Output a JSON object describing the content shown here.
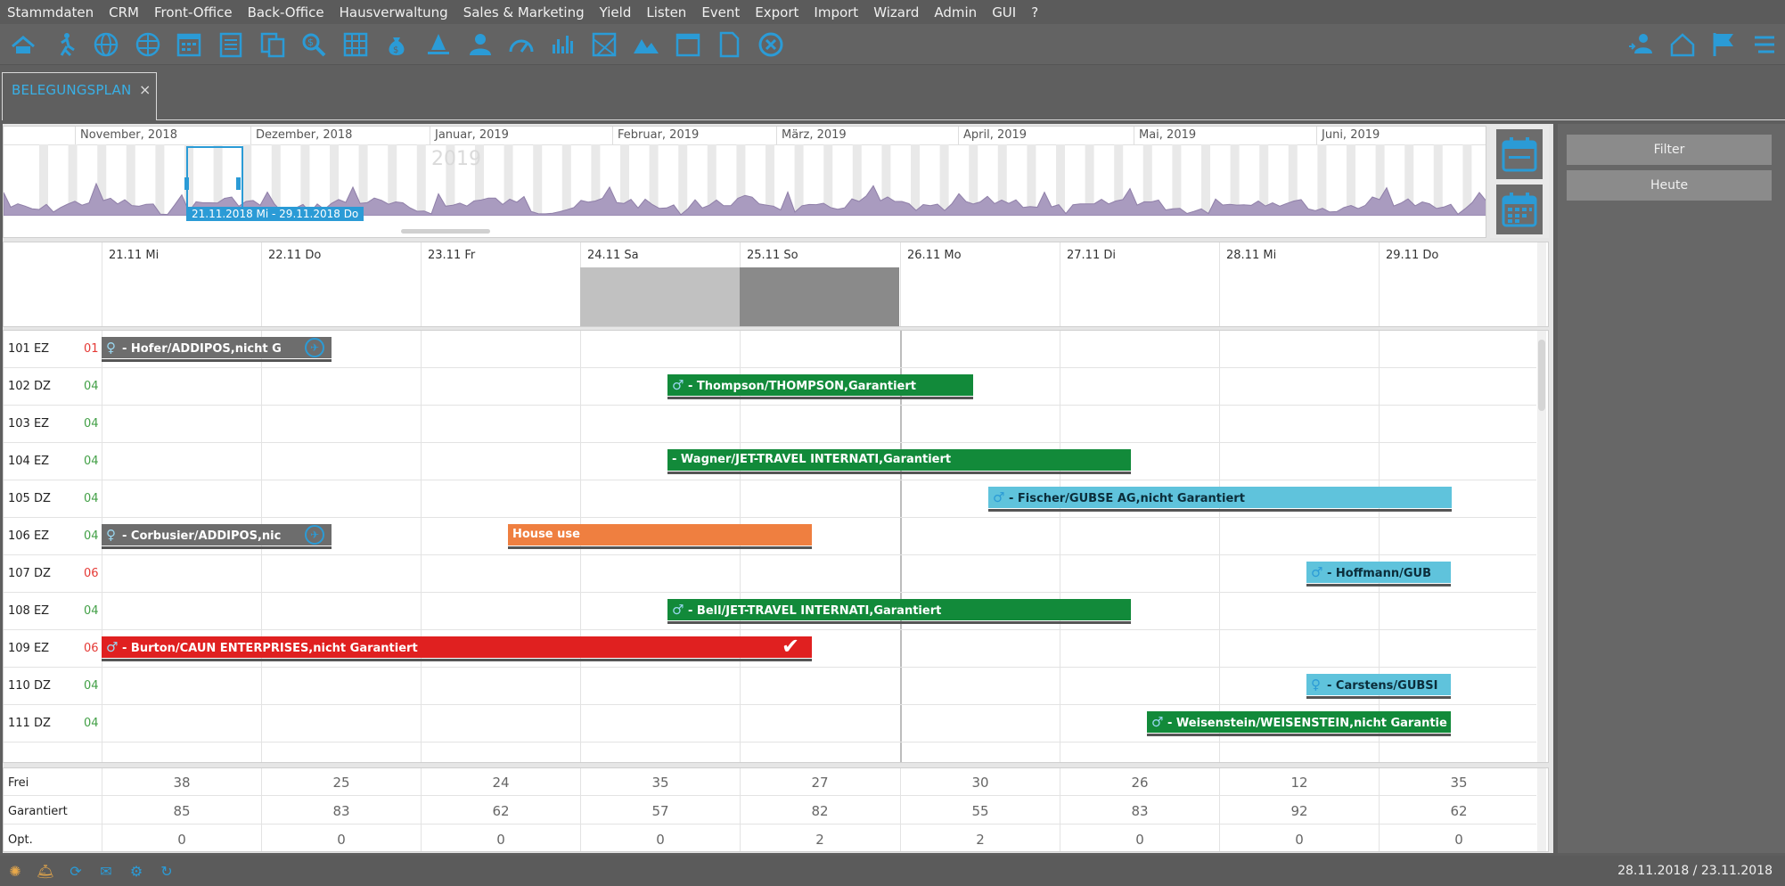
{
  "menu": [
    "Stammdaten",
    "CRM",
    "Front-Office",
    "Back-Office",
    "Hausverwaltung",
    "Sales & Marketing",
    "Yield",
    "Listen",
    "Event",
    "Export",
    "Import",
    "Wizard",
    "Admin",
    "GUI",
    "?"
  ],
  "toolbar_icons": [
    "hotel-icon",
    "walk-in-icon",
    "globe-icon",
    "globe-grid-icon",
    "calendar-grid-icon",
    "list-icon",
    "documents-icon",
    "money-search-icon",
    "table-icon",
    "moneybag-icon",
    "bell-icon",
    "person-icon",
    "gauge-icon",
    "bar-chart-icon",
    "map-icon",
    "mountains-icon",
    "calendar-icon",
    "document-icon",
    "close-circle-icon"
  ],
  "toolbar_right_icons": [
    "user-switch-icon",
    "home-icon",
    "flag-icon",
    "menu-icon"
  ],
  "tab": {
    "label": "BELEGUNGSPLAN",
    "close": "×"
  },
  "overview": {
    "months": [
      "November, 2018",
      "Dezember, 2018",
      "Januar, 2019",
      "Februar, 2019",
      "März, 2019",
      "April, 2019",
      "Mai, 2019",
      "Juni, 2019"
    ],
    "year": "2019",
    "selection_label": "21.11.2018 Mi - 29.11.2018 Do"
  },
  "days": [
    "21.11 Mi",
    "22.11 Do",
    "23.11 Fr",
    "24.11 Sa",
    "25.11 So",
    "26.11 Mo",
    "27.11 Di",
    "28.11 Mi",
    "29.11 Do"
  ],
  "rooms": [
    {
      "name": "101 EZ",
      "code": "01",
      "code_color": "#e53935"
    },
    {
      "name": "102 DZ",
      "code": "04",
      "code_color": "#43a047"
    },
    {
      "name": "103 EZ",
      "code": "04",
      "code_color": "#43a047"
    },
    {
      "name": "104 EZ",
      "code": "04",
      "code_color": "#43a047"
    },
    {
      "name": "105 DZ",
      "code": "04",
      "code_color": "#43a047"
    },
    {
      "name": "106 EZ",
      "code": "04",
      "code_color": "#43a047"
    },
    {
      "name": "107 DZ",
      "code": "06",
      "code_color": "#e53935"
    },
    {
      "name": "108 EZ",
      "code": "04",
      "code_color": "#43a047"
    },
    {
      "name": "109 EZ",
      "code": "06",
      "code_color": "#e53935"
    },
    {
      "name": "110 DZ",
      "code": "04",
      "code_color": "#43a047"
    },
    {
      "name": "111 DZ",
      "code": "04",
      "code_color": "#43a047"
    }
  ],
  "bookings": [
    {
      "label": "- Hofer/ADDIPOS,nicht G",
      "icon": "♀",
      "color": "#6d6d6d"
    },
    {
      "label": "- Thompson/THOMPSON,Garantiert",
      "icon": "♂",
      "color": "#128a3a"
    },
    {
      "label": "- Wagner/JET-TRAVEL INTERNATI,Garantiert",
      "icon": "",
      "color": "#128a3a"
    },
    {
      "label": "- Fischer/GUBSE AG,nicht Garantiert",
      "icon": "♂",
      "color": "#5fc3dc"
    },
    {
      "label": "- Corbusier/ADDIPOS,nic",
      "icon": "♀",
      "color": "#6d6d6d"
    },
    {
      "label": "House use",
      "icon": "",
      "color": "#ef7f40"
    },
    {
      "label": "- Hoffmann/GUB",
      "icon": "♂",
      "color": "#5fc3dc"
    },
    {
      "label": "- Bell/JET-TRAVEL INTERNATI,Garantiert",
      "icon": "♂",
      "color": "#128a3a"
    },
    {
      "label": "- Burton/CAUN ENTERPRISES,nicht Garantiert",
      "icon": "♂",
      "color": "#e02020"
    },
    {
      "label": "- Carstens/GUBSI",
      "icon": "♀",
      "color": "#5fc3dc"
    },
    {
      "label": "- Weisenstein/WEISENSTEIN,nicht Garantie",
      "icon": "♂",
      "color": "#128a3a"
    }
  ],
  "summary": [
    {
      "label": "Frei",
      "values": [
        "38",
        "25",
        "24",
        "35",
        "27",
        "30",
        "26",
        "12",
        "35"
      ]
    },
    {
      "label": "Garantiert",
      "values": [
        "85",
        "83",
        "62",
        "57",
        "82",
        "55",
        "83",
        "92",
        "62"
      ]
    },
    {
      "label": "Opt.",
      "values": [
        "0",
        "0",
        "0",
        "0",
        "2",
        "2",
        "0",
        "0",
        "0"
      ]
    }
  ],
  "right_panel": {
    "filter": "Filter",
    "today": "Heute"
  },
  "status": {
    "date": "28.11.2018 / 23.11.2018"
  }
}
